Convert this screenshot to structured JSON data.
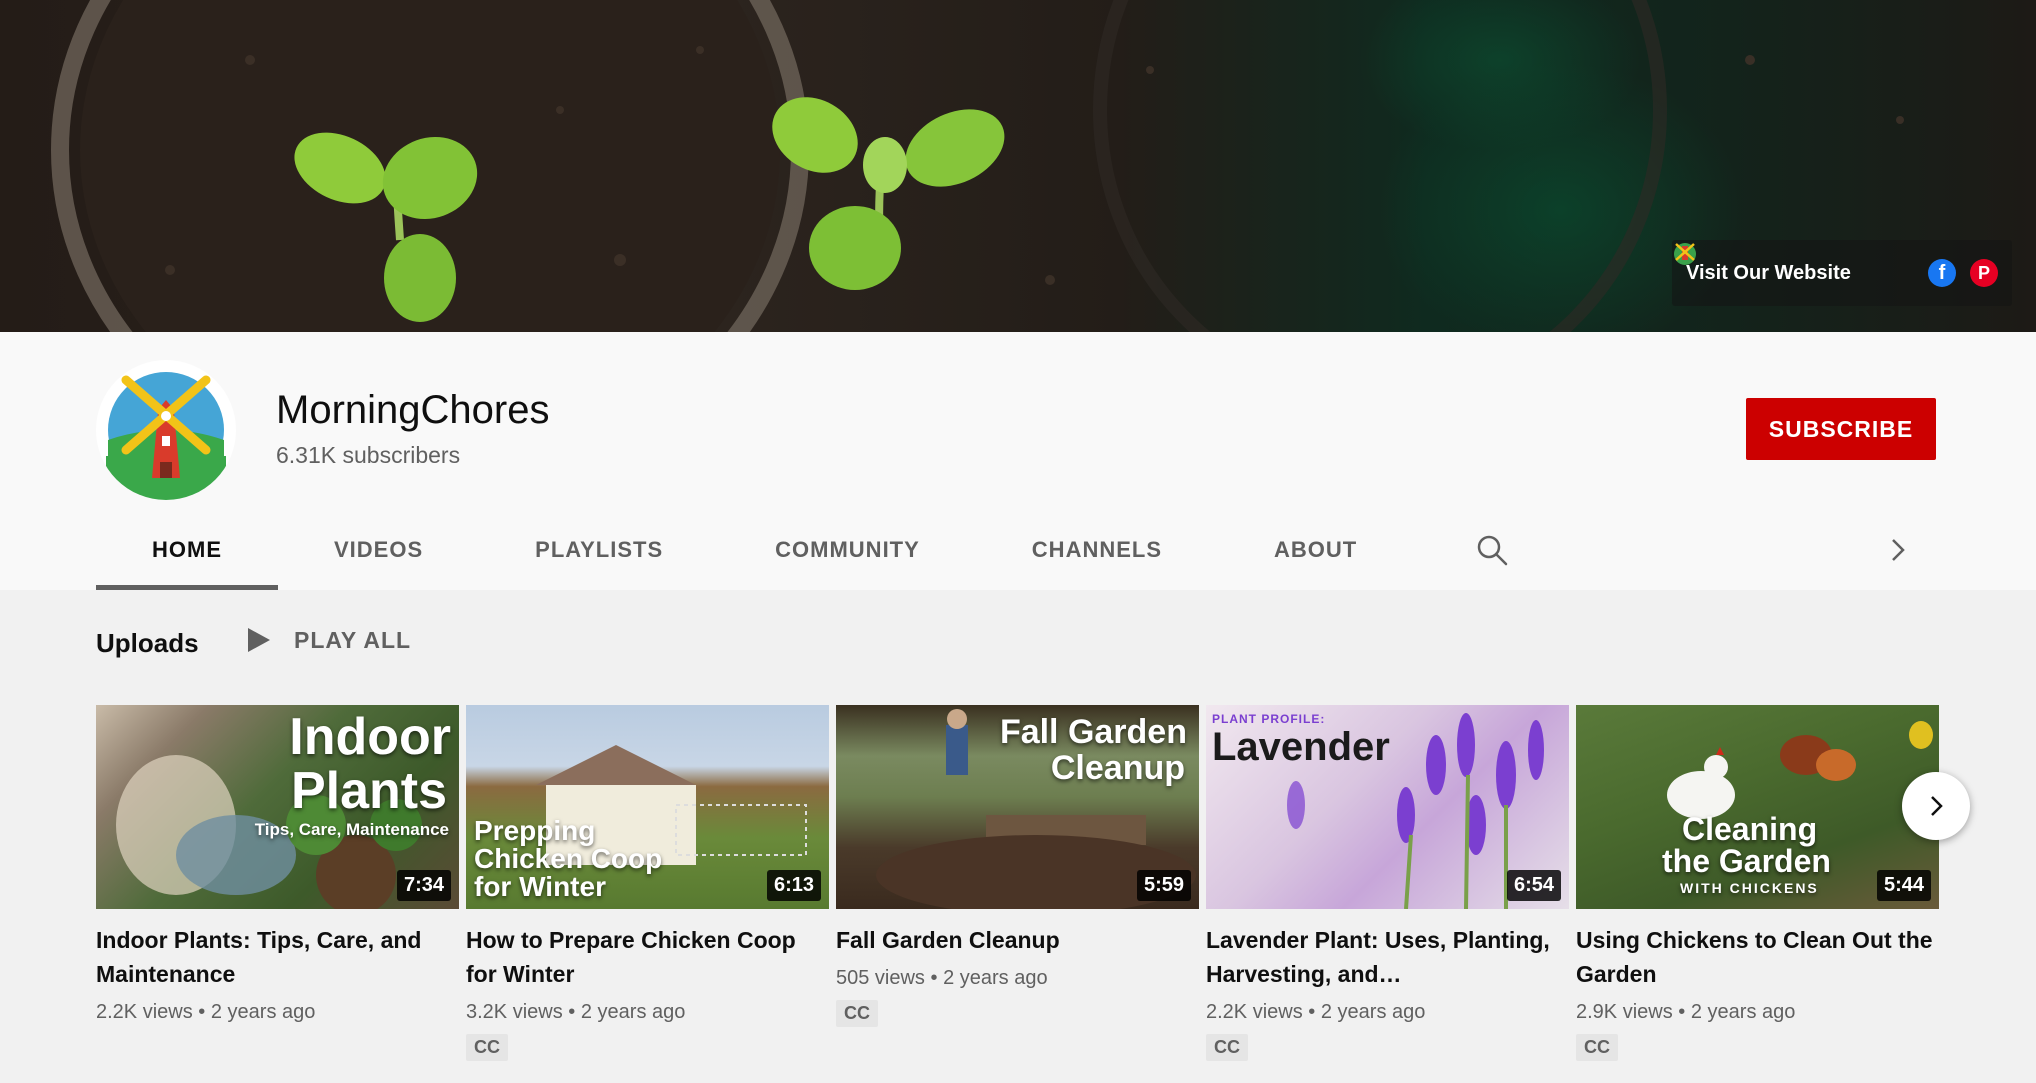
{
  "banner": {
    "visit_label": "Visit Our Website",
    "icons": [
      "website-favicon-icon",
      "facebook-icon",
      "pinterest-icon"
    ],
    "facebook_glyph": "f",
    "pinterest_glyph": "P"
  },
  "channel": {
    "name": "MorningChores",
    "subscribers": "6.31K subscribers",
    "subscribe_label": "SUBSCRIBE"
  },
  "tabs": [
    {
      "label": "HOME",
      "active": true
    },
    {
      "label": "VIDEOS"
    },
    {
      "label": "PLAYLISTS"
    },
    {
      "label": "COMMUNITY"
    },
    {
      "label": "CHANNELS"
    },
    {
      "label": "ABOUT"
    }
  ],
  "shelf": {
    "title": "Uploads",
    "play_all": "PLAY ALL"
  },
  "videos": [
    {
      "title": "Indoor Plants: Tips, Care, and Maintenance",
      "views": "2.2K views",
      "age": "2 years ago",
      "duration": "7:34",
      "cc": "",
      "thumb_line1": "Indoor",
      "thumb_line2": "Plants",
      "thumb_line3": "Tips, Care, Maintenance"
    },
    {
      "title": "How to Prepare Chicken Coop for Winter",
      "views": "3.2K views",
      "age": "2 years ago",
      "duration": "6:13",
      "cc": "CC",
      "thumb_line1": "Prepping",
      "thumb_line2": "Chicken Coop",
      "thumb_line3": "for Winter"
    },
    {
      "title": "Fall Garden Cleanup",
      "views": "505 views",
      "age": "2 years ago",
      "duration": "5:59",
      "cc": "CC",
      "thumb_line1": "Fall Garden",
      "thumb_line2": "Cleanup"
    },
    {
      "title": "Lavender Plant: Uses, Planting, Harvesting, and…",
      "views": "2.2K views",
      "age": "2 years ago",
      "duration": "6:54",
      "cc": "CC",
      "thumb_line1": "PLANT PROFILE:",
      "thumb_line2": "Lavender"
    },
    {
      "title": "Using Chickens to Clean Out the Garden",
      "views": "2.9K views",
      "age": "2 years ago",
      "duration": "5:44",
      "cc": "CC",
      "thumb_line1": "Cleaning",
      "thumb_line2": "the Garden",
      "thumb_line3": "WITH CHICKENS"
    }
  ],
  "meta_separator": "•"
}
